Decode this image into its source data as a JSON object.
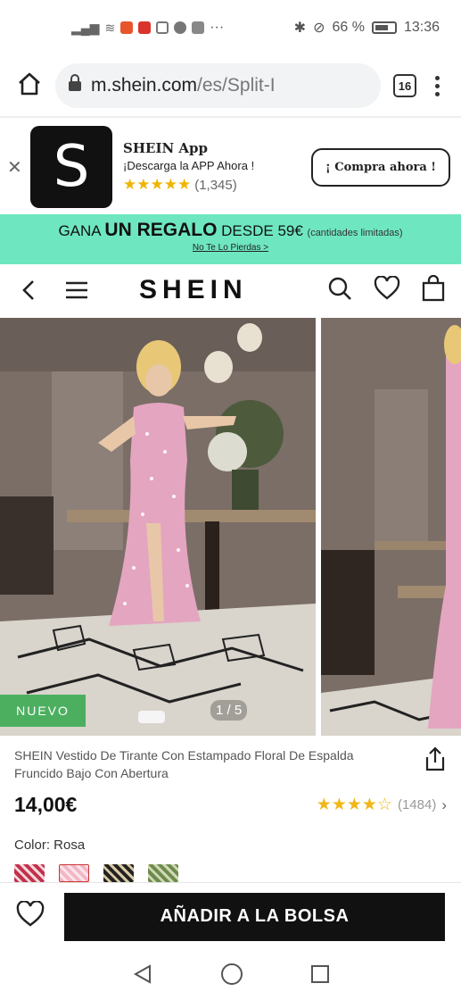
{
  "status_bar": {
    "signal": "…ıl",
    "battery_pct": "66 %",
    "time": "13:36",
    "more": "···"
  },
  "browser": {
    "url_domain": "m.shein.com",
    "url_path": "/es/Split-I",
    "tab_count": "16"
  },
  "app_banner": {
    "logo_letter": "S",
    "name": "SHEIN App",
    "tagline": "¡Descarga la APP Ahora !",
    "stars": "★★★★★",
    "rating_count": "(1,345)",
    "cta": "¡ Compra ahora !"
  },
  "promo": {
    "prefix": "GANA ",
    "highlight": "UN REGALO",
    "suffix": " DESDE 59€ ",
    "note": "(cantidades limitadas)",
    "link": "No Te Lo Pierdas >"
  },
  "header": {
    "brand": "SHEIN"
  },
  "gallery": {
    "badge": "NUEVO",
    "pager": "1 / 5"
  },
  "product": {
    "title": "SHEIN Vestido De Tirante Con Estampado Floral De Espalda Fruncido Bajo Con Abertura",
    "price": "14,00€",
    "review_stars": "★★★★☆",
    "review_count": "(1484)",
    "review_rating": 4.5,
    "color_label": "Color: Rosa"
  },
  "colors": {
    "accent_promo": "#6ee7c0",
    "badge_new": "#4caf60",
    "star": "#f2b617",
    "cta_bg": "#111111"
  },
  "actions": {
    "add_to_bag": "AÑADIR A LA BOLSA"
  }
}
